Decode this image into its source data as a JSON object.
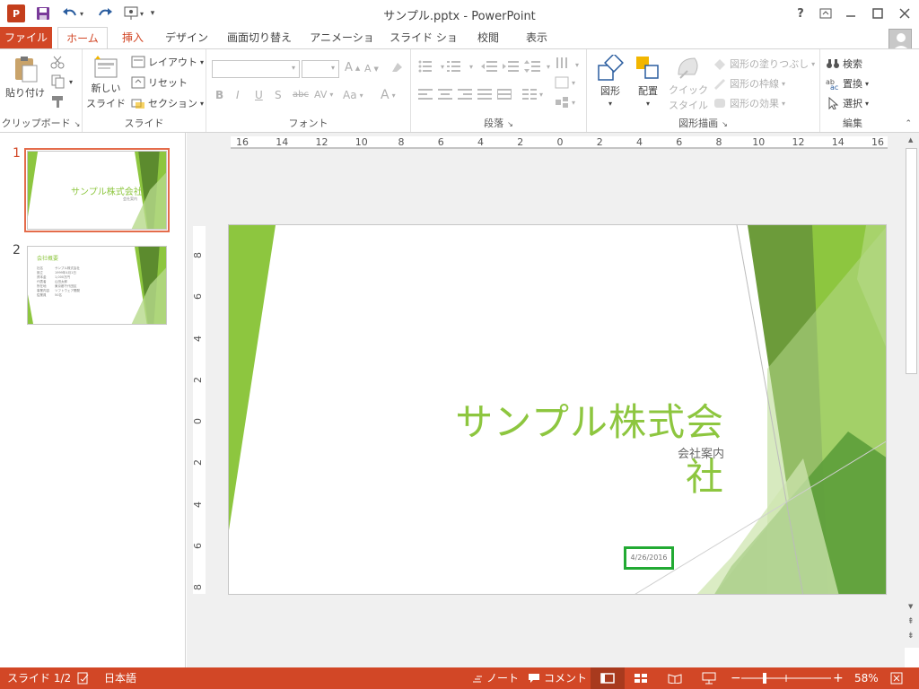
{
  "window": {
    "title": "サンプル.pptx - PowerPoint",
    "app_logo": "P"
  },
  "title_controls": {
    "help": "?"
  },
  "tabs": [
    {
      "label": "ファイル"
    },
    {
      "label": "ホーム"
    },
    {
      "label": "挿入"
    },
    {
      "label": "デザイン"
    },
    {
      "label": "画面切り替え"
    },
    {
      "label": "アニメーション"
    },
    {
      "label": "スライド ショー"
    },
    {
      "label": "校閲"
    },
    {
      "label": "表示"
    }
  ],
  "ribbon": {
    "clipboard": {
      "label": "クリップボード",
      "paste": "貼り付け"
    },
    "slides": {
      "label": "スライド",
      "new_slide_1": "新しい",
      "new_slide_2": "スライド",
      "layout": "レイアウト",
      "reset": "リセット",
      "section": "セクション"
    },
    "font": {
      "label": "フォント",
      "grow": "A",
      "shrink": "A",
      "bold": "B",
      "italic": "I",
      "underline": "U",
      "shadow": "S",
      "strike": "abc",
      "spacing": "AV",
      "case": "Aa",
      "color": "A"
    },
    "paragraph": {
      "label": "段落"
    },
    "drawing": {
      "label": "図形描画",
      "shapes": "図形",
      "arrange": "配置",
      "quick_styles_1": "クイック",
      "quick_styles_2": "スタイル",
      "fill": "図形の塗りつぶし",
      "outline": "図形の枠線",
      "effects": "図形の効果"
    },
    "editing": {
      "label": "編集",
      "find": "検索",
      "replace": "置換",
      "select": "選択"
    }
  },
  "thumbnails": [
    {
      "number": "1",
      "title": "サンプル株式会社",
      "subtitle": "会社案内"
    },
    {
      "number": "2",
      "title": "会社概要",
      "lines": [
        "社名",
        "設立",
        "資本金",
        "代表者",
        "所在地",
        "事業内容",
        "従業員"
      ],
      "values": [
        "サンプル株式会社",
        "1999年4月1日",
        "1,000万円",
        "山田太郎",
        "東京都千代田区",
        "ソフトウェア開発",
        "50名"
      ]
    }
  ],
  "ruler": {
    "h_ticks": [
      "16",
      "14",
      "12",
      "10",
      "8",
      "6",
      "4",
      "2",
      "0",
      "2",
      "4",
      "6",
      "8",
      "10",
      "12",
      "14",
      "16"
    ],
    "v_ticks": [
      "8",
      "6",
      "4",
      "2",
      "0",
      "2",
      "4",
      "6",
      "8"
    ]
  },
  "slide": {
    "title": "サンプル株式会社",
    "subtitle": "会社案内",
    "date": "4/26/2016"
  },
  "colors": {
    "accent": "#d24726",
    "green_dark": "#5c8b2e",
    "green": "#8dc63f",
    "green_light": "#b7d98b",
    "title_green": "#8dc63f",
    "date_box": "#22aa33"
  },
  "status": {
    "slide_indicator": "スライド 1/2",
    "language": "日本語",
    "notes": "ノート",
    "comments": "コメント",
    "zoom": "58%"
  }
}
